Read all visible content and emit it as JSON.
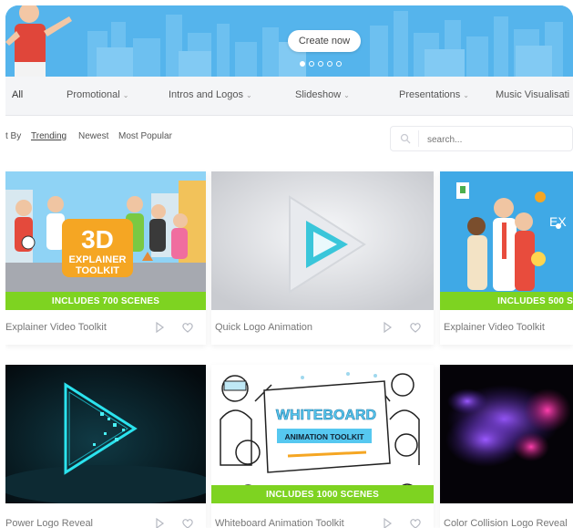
{
  "hero": {
    "cta_label": "Create now",
    "slides": [
      true,
      false,
      false,
      false,
      false
    ]
  },
  "categories": [
    {
      "label": "All",
      "has_dropdown": false,
      "active": true
    },
    {
      "label": "Promotional",
      "has_dropdown": true
    },
    {
      "label": "Intros and Logos",
      "has_dropdown": true
    },
    {
      "label": "Slideshow",
      "has_dropdown": true
    },
    {
      "label": "Presentations",
      "has_dropdown": true
    },
    {
      "label": "Music Visualisati",
      "has_dropdown": false
    }
  ],
  "sort": {
    "label": "t By",
    "options": [
      "Trending",
      "Newest",
      "Most Popular"
    ],
    "active": "Trending"
  },
  "search": {
    "placeholder": "search..."
  },
  "cards": [
    {
      "title": "Explainer Video Toolkit",
      "badge": "INCLUDES 700 SCENES",
      "thumb_text": [
        "3D",
        "EXPLAINER",
        "TOOLKIT"
      ]
    },
    {
      "title": "Quick Logo Animation",
      "badge": ""
    },
    {
      "title": "Explainer Video Toolkit",
      "badge": "INCLUDES 500 S",
      "thumb_text": [
        "EX"
      ]
    },
    {
      "title": "Power Logo Reveal",
      "badge": ""
    },
    {
      "title": "Whiteboard Animation Toolkit",
      "badge": "INCLUDES 1000 SCENES",
      "thumb_text": [
        "WHITEBOARD",
        "ANIMATION TOOLKIT"
      ]
    },
    {
      "title": "Color Collision Logo Reveal",
      "badge": ""
    }
  ],
  "colors": {
    "hero_bg": "#4fb0ea",
    "badge_green": "#7ed321",
    "accent_orange": "#f5a623"
  }
}
